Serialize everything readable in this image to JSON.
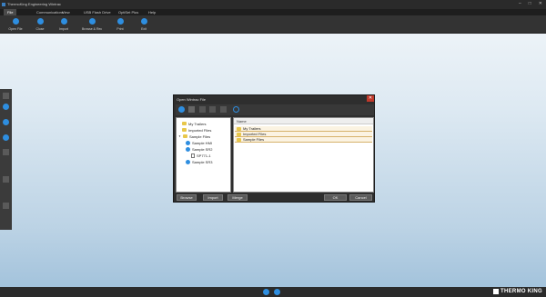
{
  "window": {
    "title": "ThermoKing Engineering Wintrac",
    "minimize": "–",
    "maximize": "□",
    "close": "✕"
  },
  "menu": [
    "File",
    "Communications",
    "View",
    "USB Flash Drive",
    "OptiSet Plus",
    "Help"
  ],
  "toolbar": [
    "Open File",
    "Close",
    "Import",
    "Browse & Rec",
    "Print",
    "Exit"
  ],
  "dialog": {
    "title": "Open Wintrac File",
    "close": "✕",
    "tree": [
      {
        "label": "My Trailers",
        "kind": "folder"
      },
      {
        "label": "Imported Files",
        "kind": "folder"
      },
      {
        "label": "Sample Files",
        "kind": "folder"
      },
      {
        "label": "Sample HMI",
        "kind": "disc"
      },
      {
        "label": "Sample SR2",
        "kind": "disc"
      },
      {
        "label": "SP771-1",
        "kind": "doc"
      },
      {
        "label": "Sample SR3",
        "kind": "disc"
      }
    ],
    "list_header": "Name",
    "list": [
      "My Trailers",
      "Imported Files",
      "Sample Files"
    ],
    "buttons": {
      "browse": "Browse",
      "import": "Import",
      "merge": "Merge",
      "ok": "OK",
      "cancel": "Cancel"
    }
  },
  "brand": "THERMO KING",
  "colors": {
    "accent": "#2e8ee0",
    "folder": "#e8c74a",
    "toolbar_bg": "#333333"
  }
}
